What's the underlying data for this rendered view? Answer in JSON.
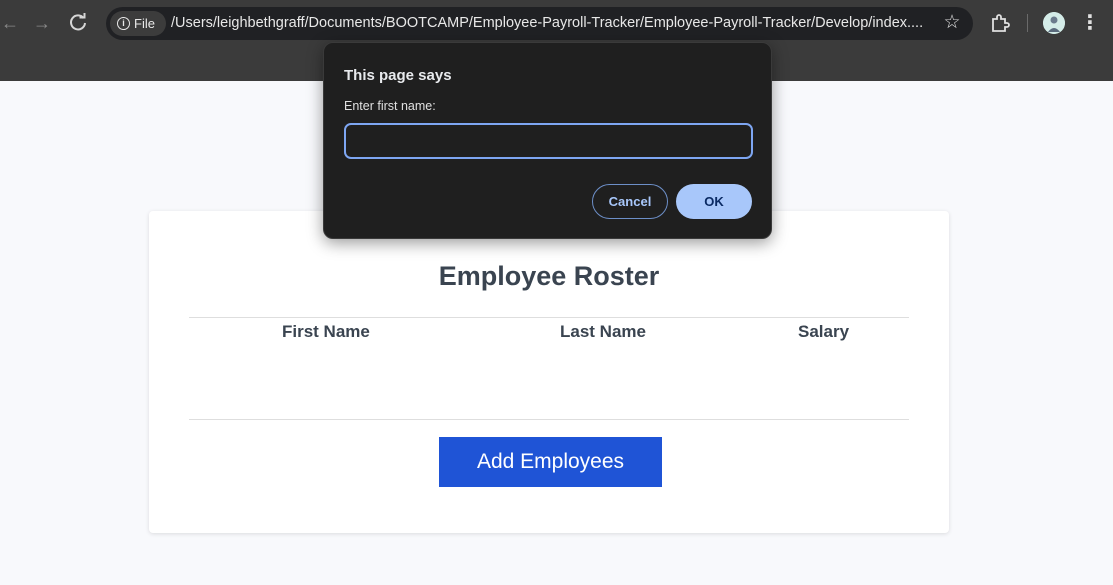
{
  "browser": {
    "site_chip_label": "File",
    "url": "/Users/leighbethgraff/Documents/BOOTCAMP/Employee-Payroll-Tracker/Employee-Payroll-Tracker/Develop/index....",
    "icons": {
      "back": "back-arrow-icon",
      "forward": "forward-arrow-icon",
      "reload": "reload-icon",
      "info": "info-icon",
      "bookmark": "star-icon",
      "extensions": "puzzle-icon",
      "profile": "avatar",
      "menu": "kebab-menu-icon"
    }
  },
  "dialog": {
    "title": "This page says",
    "message": "Enter first name:",
    "input_value": "",
    "cancel_label": "Cancel",
    "ok_label": "OK"
  },
  "page": {
    "title": "Employee Roster",
    "columns": [
      "First Name",
      "Last Name",
      "Salary"
    ],
    "rows": [],
    "add_button_label": "Add Employees"
  },
  "colors": {
    "accent": "#1f54d6",
    "dialog_bg": "#1f1f1f",
    "dialog_primary": "#a8c7fa",
    "chrome_bg": "#3b3b3b",
    "page_bg": "#f8f9fc"
  }
}
